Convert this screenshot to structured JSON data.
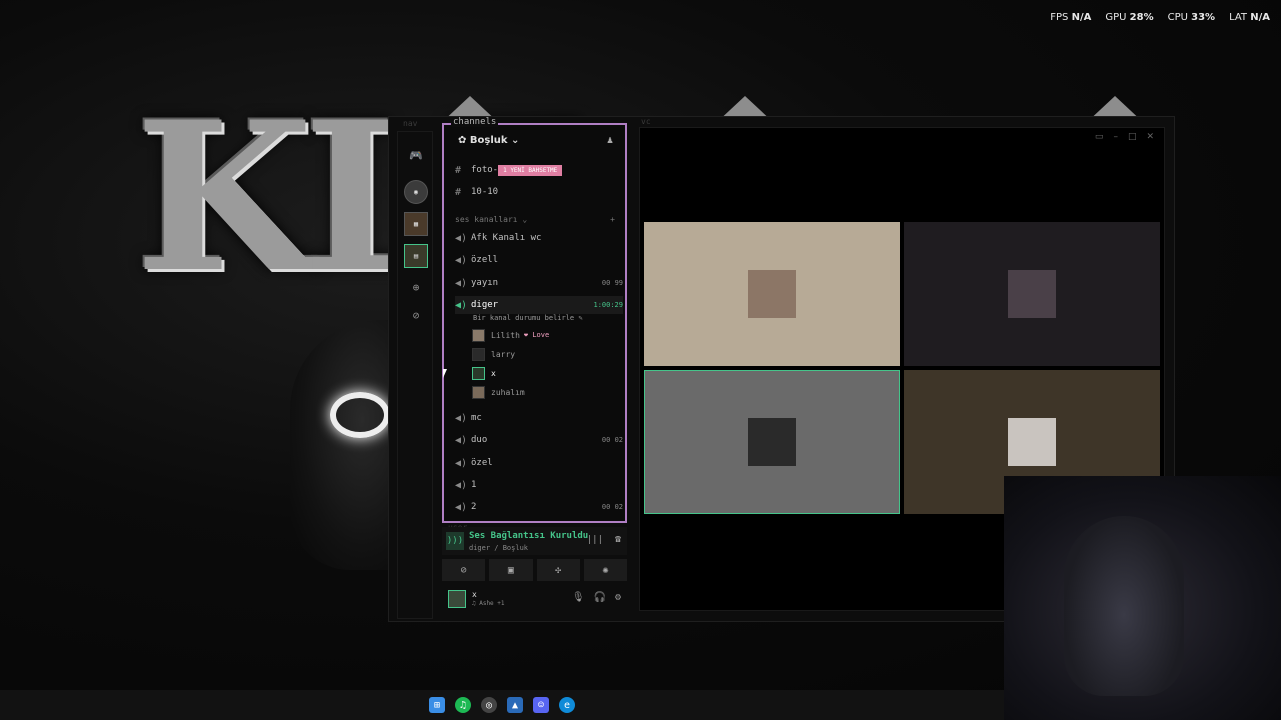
{
  "overlay_stats": {
    "fps_label": "FPS",
    "fps_value": "N/A",
    "gpu_label": "GPU",
    "gpu_value": "28%",
    "cpu_label": "CPU",
    "cpu_value": "33%",
    "lat_label": "LAT",
    "lat_value": "N/A"
  },
  "wallpaper_text": "KLE",
  "window": {
    "nav_label": "nav",
    "channels_label": "channels",
    "vc_label": "vc",
    "user_label": "user"
  },
  "server": {
    "name": "Boşluk ⌄"
  },
  "text_channels": [
    {
      "name": "foto-",
      "badge": "1 YENİ BAHSETME"
    },
    {
      "name": "10-10"
    }
  ],
  "voice_section": "ses kanalları ⌄",
  "voice_channels": [
    {
      "name": "Afk Kanalı wc",
      "right": ""
    },
    {
      "name": "özell",
      "right": ""
    },
    {
      "name": "yayın",
      "right": "00  99"
    },
    {
      "name": "diger",
      "right": "1:00:29",
      "status": "Bir kanal durumu belirle ✎"
    },
    {
      "name": "mc",
      "right": ""
    },
    {
      "name": "duo",
      "right": "00  02"
    },
    {
      "name": "özel",
      "right": ""
    },
    {
      "name": "1",
      "right": ""
    },
    {
      "name": "2",
      "right": "00  02"
    }
  ],
  "members": [
    {
      "name": "Lilith",
      "tag": "❤ Love"
    },
    {
      "name": "larry",
      "tag": ""
    },
    {
      "name": "x",
      "tag": ""
    },
    {
      "name": "zuhalım",
      "tag": ""
    }
  ],
  "voice_status": {
    "title": "Ses Bağlantısı Kuruldu",
    "sub": "diger / Boşluk"
  },
  "me": {
    "name": "x",
    "status": "♫ Ashe +1"
  },
  "tiles": [
    {
      "bg": "#b7aa96"
    },
    {
      "bg": "#1f1c20"
    },
    {
      "bg": "#6a6a6a"
    },
    {
      "bg": "#3e3528"
    }
  ],
  "colors": {
    "accent": "#b07fc4",
    "connected": "#45c48a",
    "badge": "#e07fa3"
  }
}
